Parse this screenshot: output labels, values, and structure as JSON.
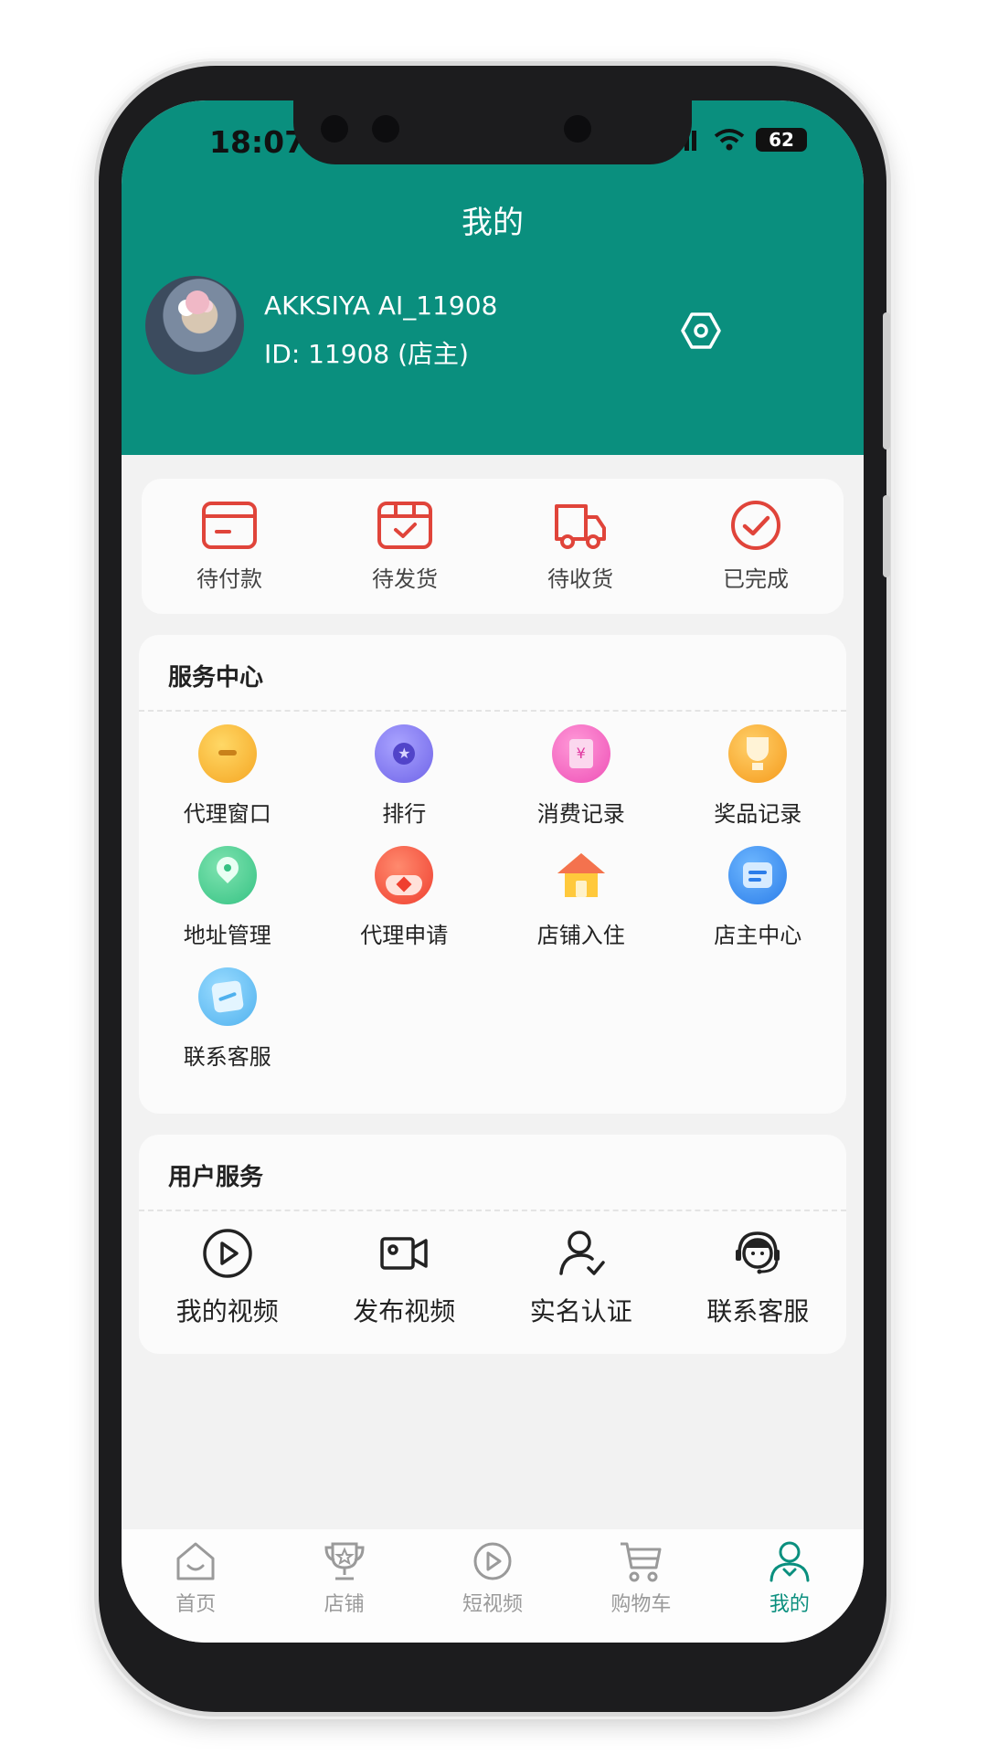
{
  "status_bar": {
    "time": "18:07",
    "battery": "62"
  },
  "header": {
    "title": "我的"
  },
  "profile": {
    "username": "AKKSIYA AI_11908",
    "user_id": "ID: 11908 (店主)"
  },
  "orders": [
    {
      "label": "待付款",
      "icon": "wallet-icon"
    },
    {
      "label": "待发货",
      "icon": "package-icon"
    },
    {
      "label": "待收货",
      "icon": "delivery-truck-icon"
    },
    {
      "label": "已完成",
      "icon": "check-circle-icon"
    }
  ],
  "service_center": {
    "title": "服务中心",
    "items": [
      {
        "label": "代理窗口",
        "icon": "agent-window-icon"
      },
      {
        "label": "排行",
        "icon": "ranking-medal-icon"
      },
      {
        "label": "消费记录",
        "icon": "spending-record-icon"
      },
      {
        "label": "奖品记录",
        "icon": "trophy-icon"
      },
      {
        "label": "地址管理",
        "icon": "location-pin-icon"
      },
      {
        "label": "代理申请",
        "icon": "agent-apply-icon"
      },
      {
        "label": "店铺入住",
        "icon": "store-house-icon"
      },
      {
        "label": "店主中心",
        "icon": "owner-center-icon"
      },
      {
        "label": "联系客服",
        "icon": "contact-service-icon"
      }
    ]
  },
  "user_services": {
    "title": "用户服务",
    "items": [
      {
        "label": "我的视频",
        "icon": "play-circle-icon"
      },
      {
        "label": "发布视频",
        "icon": "video-camera-icon"
      },
      {
        "label": "实名认证",
        "icon": "user-verified-icon"
      },
      {
        "label": "联系客服",
        "icon": "headset-agent-icon"
      }
    ]
  },
  "tabbar": {
    "items": [
      {
        "label": "首页",
        "icon": "home-icon"
      },
      {
        "label": "店铺",
        "icon": "store-trophy-icon"
      },
      {
        "label": "短视频",
        "icon": "short-video-icon"
      },
      {
        "label": "购物车",
        "icon": "cart-icon"
      },
      {
        "label": "我的",
        "icon": "profile-icon"
      }
    ],
    "active_index": 4
  },
  "colors": {
    "brand": "#0a8f7e",
    "order_icon": "#e0443a",
    "background": "#f2f2f2"
  }
}
